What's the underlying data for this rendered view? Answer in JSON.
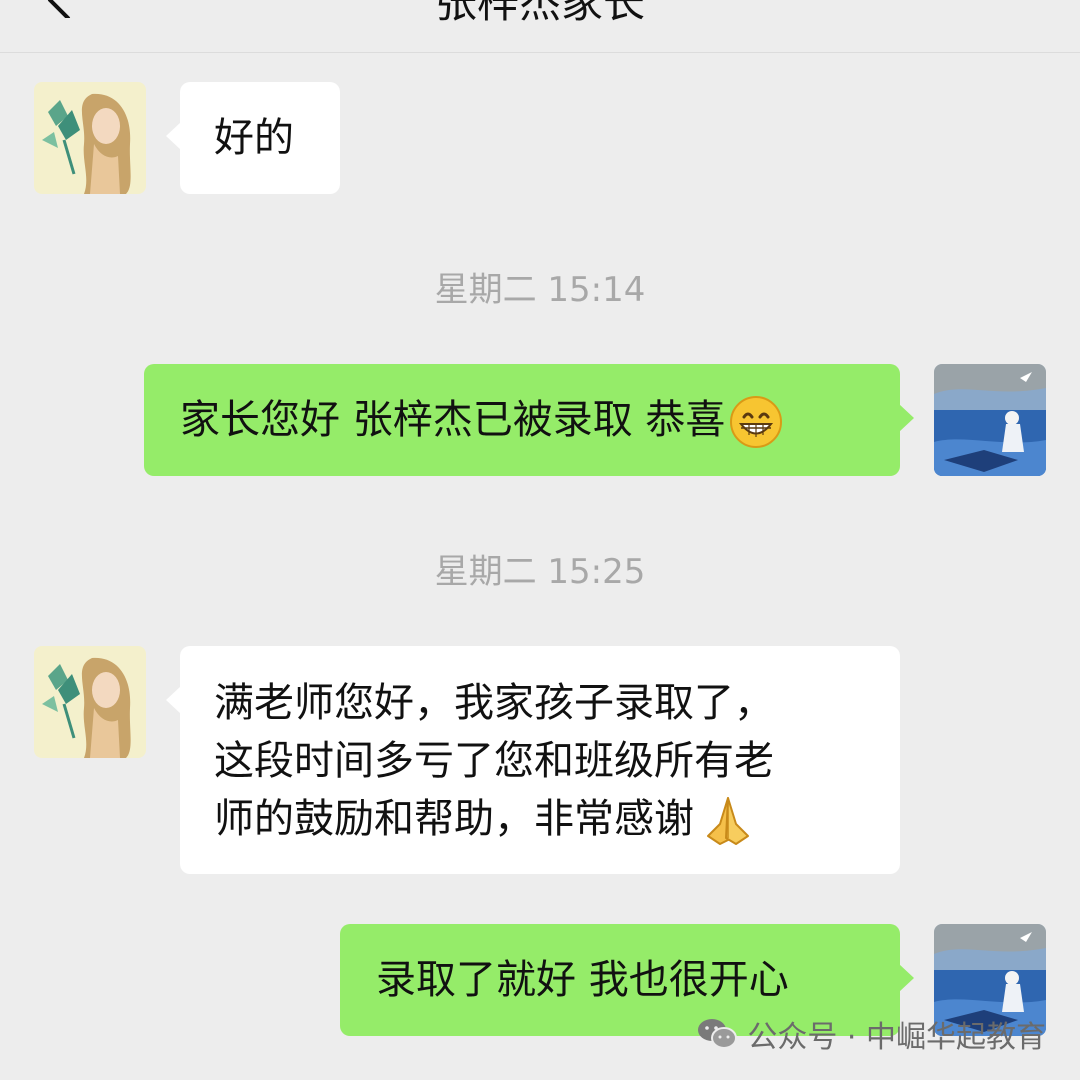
{
  "header": {
    "title": "张梓杰家长",
    "back_icon": "chevron-left-icon"
  },
  "messages": [
    {
      "side": "left",
      "text": "好的"
    },
    {
      "type": "time",
      "text": "星期二 15:14"
    },
    {
      "side": "right",
      "text": "家长您好 张梓杰已被录取 恭喜",
      "emoji": "grinning-face-emoji"
    },
    {
      "type": "time",
      "text": "星期二 15:25"
    },
    {
      "side": "left",
      "lines": [
        "满老师您好，我家孩子录取了，",
        "这段时间多亏了您和班级所有老",
        "师的鼓励和帮助，非常感谢"
      ],
      "emoji": "folded-hands-emoji"
    },
    {
      "side": "right",
      "text": "录取了就好 我也很开心"
    }
  ],
  "watermark": {
    "label": "公众号 · 中崛华起教育",
    "icon": "wechat-icon"
  },
  "colors": {
    "background": "#ededed",
    "sent_bubble": "#95ec69",
    "received_bubble": "#ffffff",
    "timestamp": "#a8a8a8"
  }
}
